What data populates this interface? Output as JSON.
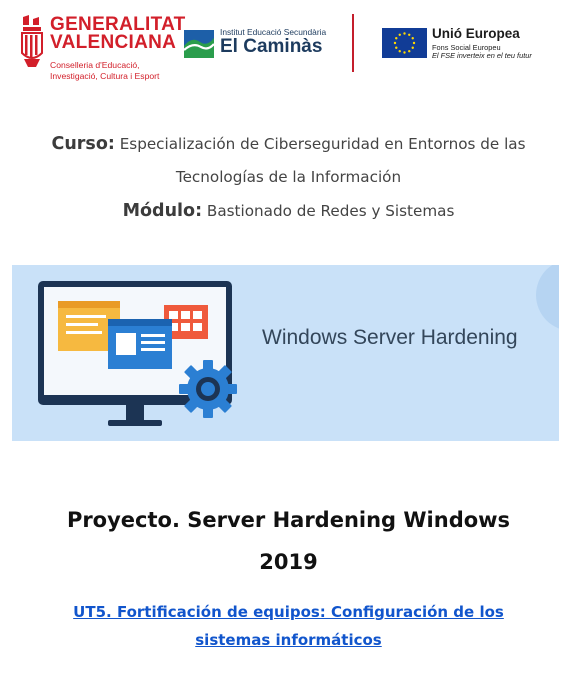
{
  "header": {
    "gva": {
      "name_line1": "GENERALITAT",
      "name_line2": "VALENCIANA",
      "sub_line1": "Conselleria d'Educació,",
      "sub_line2": "Investigació, Cultura i Esport"
    },
    "school": {
      "institute_label": "Institut Educació Secundària",
      "name": "El Caminàs"
    },
    "eu": {
      "name": "Unió Europea",
      "fund": "Fons Social Europeu",
      "motto": "El FSE inverteix en el teu futur"
    }
  },
  "course": {
    "label": "Curso:",
    "value_line1": "Especialización de Ciberseguridad en Entornos de las",
    "value_line2": "Tecnologías de la Información"
  },
  "module": {
    "label": "Módulo:",
    "value": "Bastionado de Redes y Sistemas"
  },
  "banner": {
    "title": "Windows Server Hardening"
  },
  "project": {
    "title_line1": "Proyecto. Server Hardening Windows",
    "title_line2": "2019"
  },
  "unit_link": {
    "line1": "UT5. Fortificación de equipos: Configuración de los",
    "line2": "sistemas informáticos"
  },
  "colors": {
    "gva_red": "#d21f2a",
    "school_navy": "#1d3b5e",
    "eu_blue": "#113c96",
    "eu_star": "#ffd800",
    "banner_bg": "#c9e1f8",
    "link_blue": "#1155cc"
  },
  "icons": [
    "gva-coat-of-arms-icon",
    "school-wave-icon",
    "eu-flag-icon",
    "monitor-illustration-icon",
    "gear-icon"
  ]
}
